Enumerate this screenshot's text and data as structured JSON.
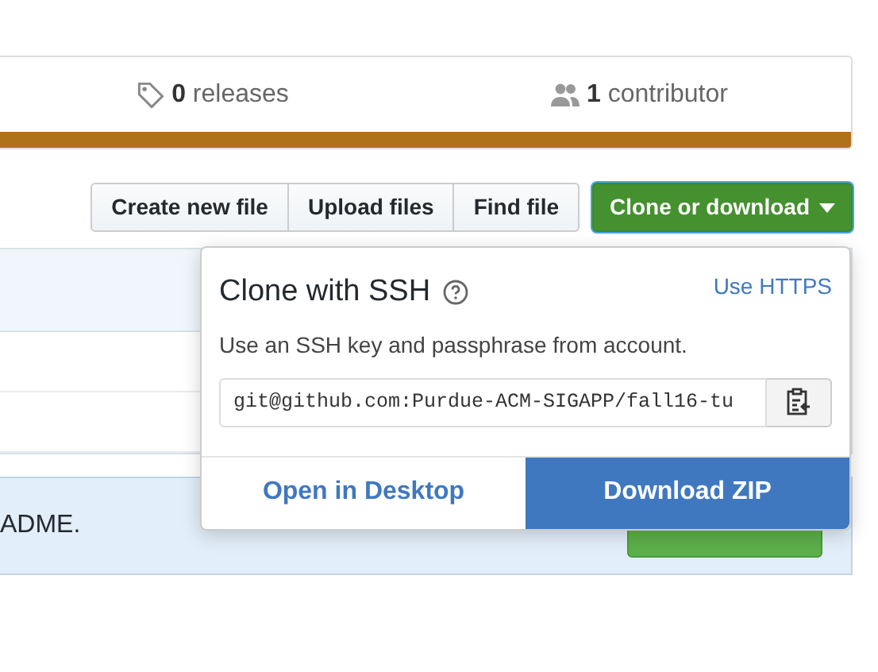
{
  "stats": [
    {
      "kind": "releases",
      "count": "0",
      "label": "releases"
    },
    {
      "kind": "contributors",
      "count": "1",
      "label": "contributor"
    }
  ],
  "language_bar": {
    "color": "#b07219"
  },
  "file_buttons": [
    "Create new file",
    "Upload files",
    "Find file"
  ],
  "clone_button": {
    "label": "Clone or download",
    "expanded": true
  },
  "readme_banner": {
    "text": "ADME."
  },
  "clone_popover": {
    "title": "Clone with SSH",
    "switch_link": "Use HTTPS",
    "description": "Use an SSH key and passphrase from account.",
    "url": "git@github.com:Purdue-ACM-SIGAPP/fall16-tu",
    "open_desktop": "Open in Desktop",
    "download": "Download ZIP"
  }
}
